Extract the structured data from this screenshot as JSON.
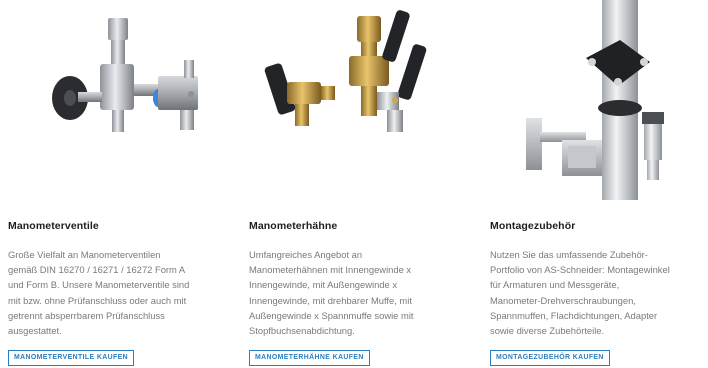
{
  "products": [
    {
      "title": "Manometerventile",
      "description_lines": [
        "Große Vielfalt an Manometerventilen",
        "gemäß DIN 16270 / 16271 / 16272 Form A",
        "und Form B. Unsere Manometerventile sind",
        "mit bzw. ohne Prüfanschluss oder auch mit",
        "getrennt absperrbarem Prüfanschluss",
        "ausgestattet."
      ],
      "button_label": "MANOMETERVENTILE KAUFEN"
    },
    {
      "title": "Manometerhähne",
      "description_lines": [
        "Umfangreiches Angebot an",
        "Manometerhähnen mit Innengewinde x",
        "Innengewinde, mit Außengewinde x",
        "Innengewinde, mit drehbarer Muffe, mit",
        "Außengewinde x Spannmuffe sowie mit",
        "Stopfbuchsenabdichtung."
      ],
      "button_label": "MANOMETERHÄHNE KAUFEN"
    },
    {
      "title": "Montagezubehör",
      "description_lines": [
        "Nutzen Sie das umfassende Zubehör-",
        "Portfolio von AS-Schneider: Montagewinkel",
        "für Armaturen und Messgeräte,",
        "Manometer-Drehverschraubungen,",
        "Spannmuffen, Flachdichtungen, Adapter",
        "sowie diverse Zubehörteile."
      ],
      "button_label": "MONTAGEZUBEHÖR KAUFEN"
    }
  ],
  "colors": {
    "accent": "#2b7fc0",
    "text_dark": "#1e1e1e",
    "text_muted": "#7a7a7a"
  }
}
